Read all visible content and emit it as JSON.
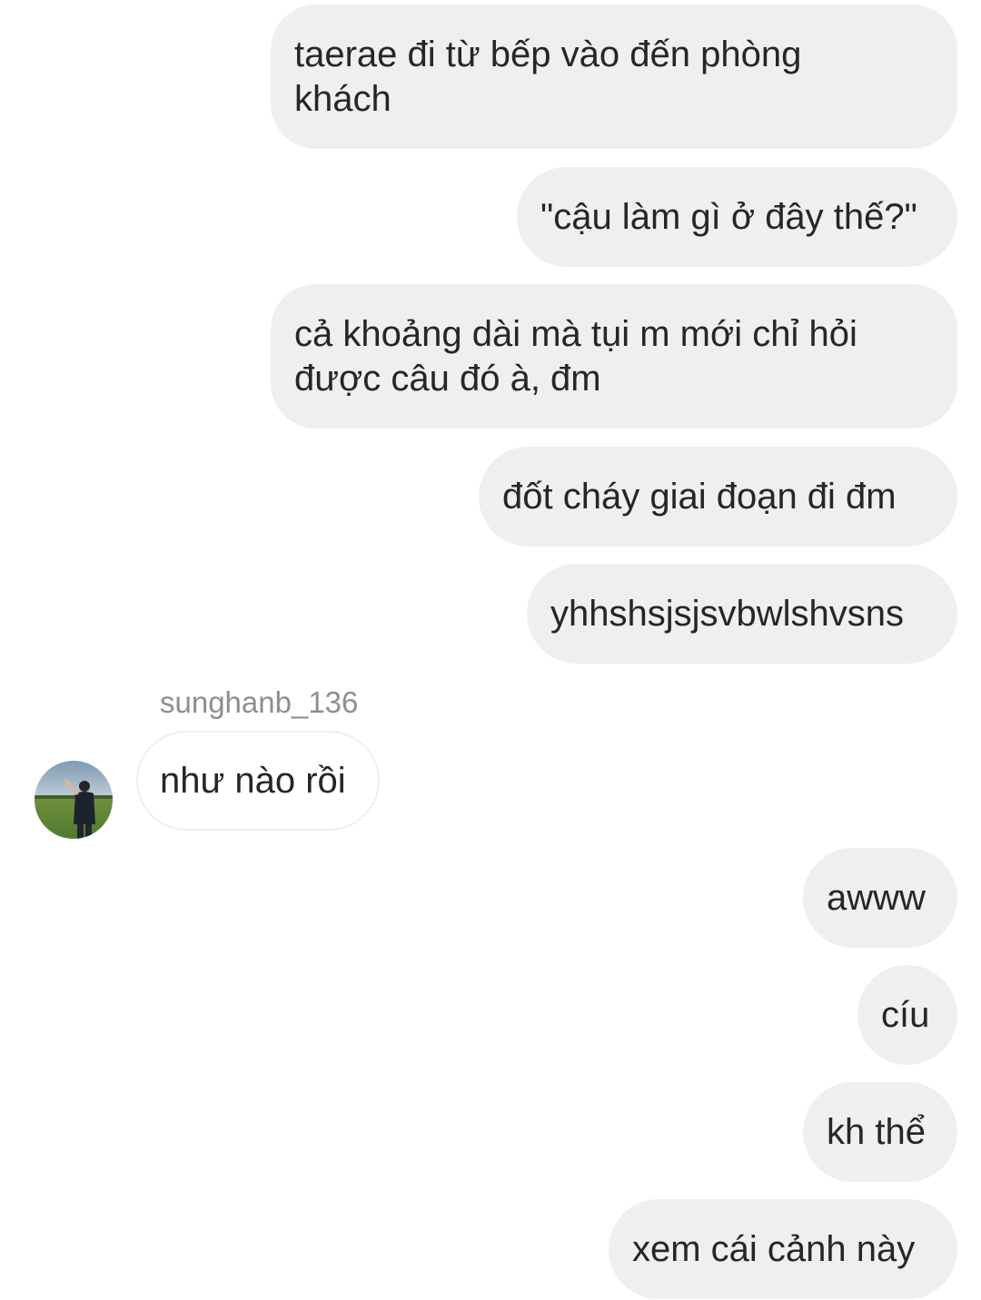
{
  "conversation": {
    "messages": [
      {
        "id": "m1",
        "direction": "sent",
        "lines": [
          "taerae đi từ bếp vào đến phòng",
          "khách"
        ]
      },
      {
        "id": "m2",
        "direction": "sent",
        "text": "\"cậu làm gì ở đây thế?\""
      },
      {
        "id": "m3",
        "direction": "sent",
        "lines": [
          "cả khoảng dài mà tụi m mới chỉ hỏi",
          "được câu đó à, đm"
        ]
      },
      {
        "id": "m4",
        "direction": "sent",
        "text": "đốt cháy giai đoạn đi đm"
      },
      {
        "id": "m5",
        "direction": "sent",
        "text": "yhhshsjsjsvbwlshvsns"
      },
      {
        "id": "m6",
        "direction": "received",
        "sender": "sunghanb_136",
        "text": "như nào rồi"
      },
      {
        "id": "m7",
        "direction": "sent",
        "text": "awww"
      },
      {
        "id": "m8",
        "direction": "sent",
        "text": "cíu"
      },
      {
        "id": "m9",
        "direction": "sent",
        "text": "kh thể"
      },
      {
        "id": "m10",
        "direction": "sent",
        "text": "xem cái cảnh này"
      }
    ]
  },
  "colors": {
    "sent_bubble": "#efefef",
    "received_border": "#efefef",
    "text": "#262626",
    "sender_name": "#8e8e8e"
  },
  "icons": {
    "avatar": "sender-avatar-photo"
  }
}
